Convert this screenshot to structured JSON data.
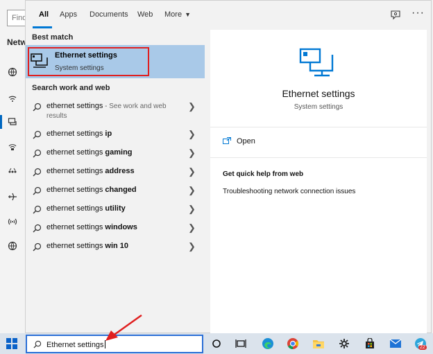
{
  "background_window": {
    "find_placeholder": "Find",
    "title": "Network"
  },
  "tabs": {
    "all": "All",
    "apps": "Apps",
    "documents": "Documents",
    "web": "Web",
    "more": "More"
  },
  "results": {
    "best_match_title": "Best match",
    "best_match": {
      "title": "Ethernet settings",
      "subtitle": "System settings"
    },
    "search_web_title": "Search work and web",
    "items": [
      {
        "prefix": "ethernet settings",
        "bold": "",
        "hint": " - See work and web",
        "hint2": "results"
      },
      {
        "prefix": "ethernet settings ",
        "bold": "ip"
      },
      {
        "prefix": "ethernet settings ",
        "bold": "gaming"
      },
      {
        "prefix": "ethernet settings ",
        "bold": "address"
      },
      {
        "prefix": "ethernet settings ",
        "bold": "changed"
      },
      {
        "prefix": "ethernet settings ",
        "bold": "utility"
      },
      {
        "prefix": "ethernet settings ",
        "bold": "windows"
      },
      {
        "prefix": "ethernet settings ",
        "bold": "win 10"
      }
    ]
  },
  "preview": {
    "title": "Ethernet settings",
    "subtitle": "System settings",
    "open_label": "Open",
    "help_title": "Get quick help from web",
    "help_link": "Troubleshooting network connection issues"
  },
  "taskbar": {
    "search_value": "Ethernet settings",
    "mail_badge": "22"
  },
  "colors": {
    "accent": "#0078d4",
    "highlight": "#a9c9e8",
    "annotation_red": "#e01f1f"
  }
}
